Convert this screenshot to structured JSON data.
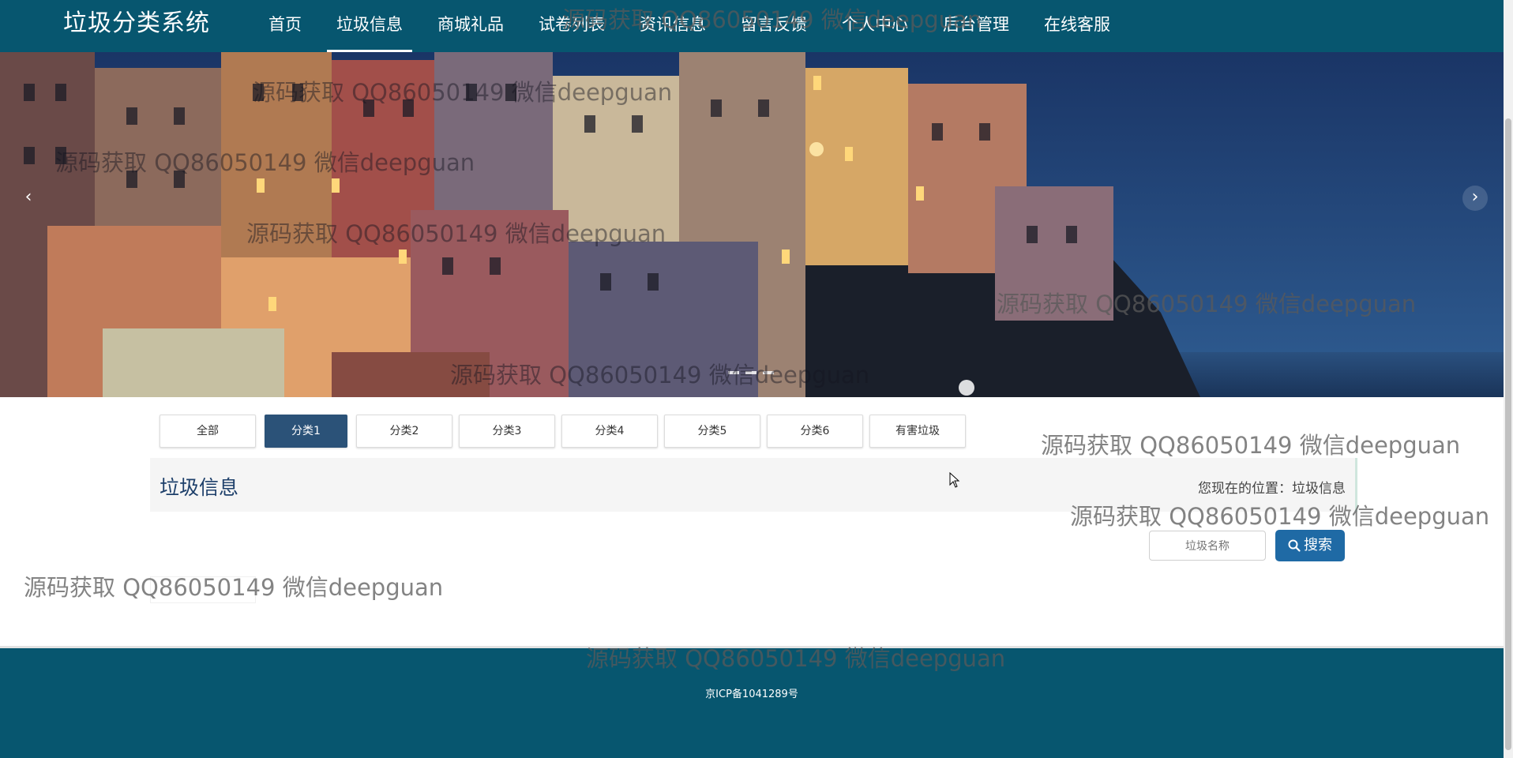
{
  "nav": {
    "brand": "垃圾分类系统",
    "items": [
      {
        "label": "首页"
      },
      {
        "label": "垃圾信息",
        "active": true
      },
      {
        "label": "商城礼品"
      },
      {
        "label": "试卷列表"
      },
      {
        "label": "资讯信息"
      },
      {
        "label": "留言反馈"
      },
      {
        "label": "个人中心"
      },
      {
        "label": "后台管理"
      },
      {
        "label": "在线客服"
      }
    ]
  },
  "banner": {
    "prev_icon": "chevron-left-icon",
    "next_icon": "chevron-right-icon",
    "slides": 3
  },
  "categories": [
    "全部",
    "分类1",
    "分类2",
    "分类3",
    "分类4",
    "分类5",
    "分类6",
    "有害垃圾"
  ],
  "active_category": "分类1",
  "section": {
    "title": "垃圾信息",
    "breadcrumb": "您现在的位置：垃圾信息"
  },
  "search": {
    "placeholder": "垃圾名称",
    "button_label": "搜索",
    "button_icon": "search-icon"
  },
  "footer": {
    "icp": "京ICP备1041289号"
  },
  "watermark": "源码获取 QQ86050149 微信deepguan",
  "colors": {
    "nav_bg": "#07566f",
    "footer_bg": "#07566f",
    "active_tab": "#2b5278",
    "search_button": "#1f6aa5"
  }
}
